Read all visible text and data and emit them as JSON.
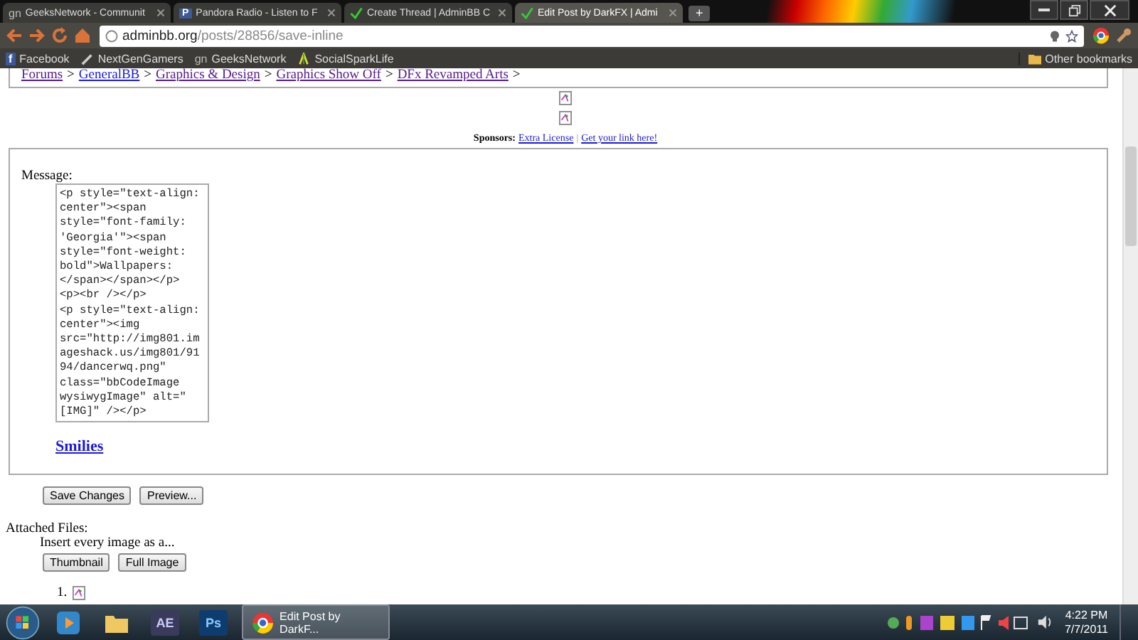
{
  "browser": {
    "tabs": [
      {
        "title": "GeeksNetwork - Communit",
        "kind": "text",
        "icon": "gn",
        "selected": false
      },
      {
        "title": "Pandora Radio - Listen to F",
        "kind": "text",
        "icon": "P",
        "selected": false
      },
      {
        "title": "Create Thread | AdminBB C",
        "kind": "check",
        "selected": false
      },
      {
        "title": "Edit Post by DarkFX | Admi",
        "kind": "check",
        "selected": true
      }
    ],
    "new_tab": "+",
    "address": {
      "domain": "adminbb.org",
      "path": "/posts/28856/save-inline"
    },
    "bookmarks": [
      {
        "label": "Facebook",
        "kind": "text",
        "icon": "f"
      },
      {
        "label": "NextGenGamers",
        "kind": "pen"
      },
      {
        "label": "GeeksNetwork",
        "kind": "text",
        "icon": "gn"
      },
      {
        "label": "SocialSparkLife",
        "kind": "lamp"
      }
    ],
    "other_bookmarks": "Other bookmarks"
  },
  "page": {
    "breadcrumbs": [
      "Forums",
      "GeneralBB",
      "Graphics & Design",
      "Graphics Show Off",
      "DFx Revamped Arts"
    ],
    "separator": ">",
    "sponsors": {
      "label": "Sponsors:",
      "links": [
        "Extra License",
        "Get your link here!"
      ],
      "divider": "|"
    },
    "message_label": "Message:",
    "message": "<p style=\"text-align: center\"><span style=\"font-family: 'Georgia'\"><span style=\"font-weight: bold\">Wallpapers: </span></span></p>\n<p><br /></p>\n<p style=\"text-align: center\"><img src=\"http://img801.imageshack.us/img801/9194/dancerwq.png\" class=\"bbCodeImage wysiwygImage\" alt=\"[IMG]\" /></p>",
    "smilies": "Smilies",
    "buttons": [
      "Save Changes",
      "Preview..."
    ],
    "attached_label": "Attached Files:",
    "insert_label": "Insert every image as a...",
    "insert_buttons": [
      "Thumbnail",
      "Full Image"
    ],
    "attachments": [
      "1."
    ]
  },
  "taskbar": {
    "apps": [
      {
        "kind": "media"
      },
      {
        "kind": "folder"
      },
      {
        "kind": "ae",
        "label": "AE"
      },
      {
        "kind": "ps",
        "label": "Ps"
      },
      {
        "kind": "chrome",
        "label": "Edit Post by DarkF...",
        "selected": true
      }
    ],
    "time": "4:22 PM",
    "date": "7/7/2011"
  }
}
